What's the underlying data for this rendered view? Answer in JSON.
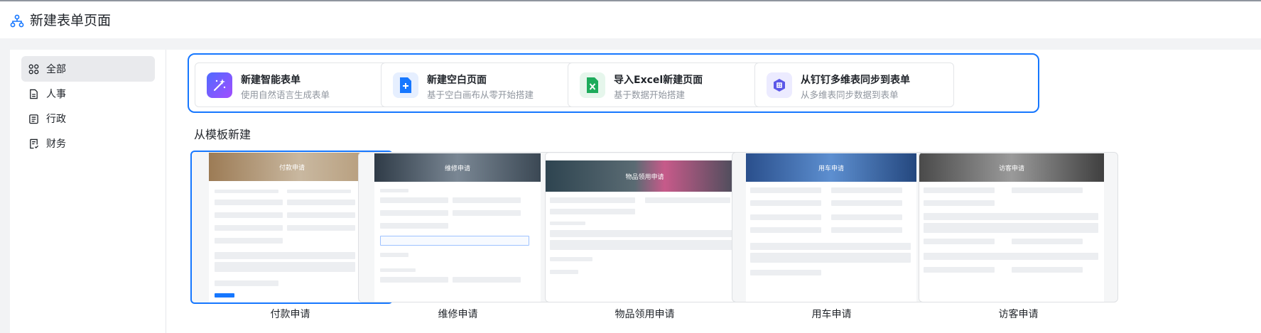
{
  "header": {
    "title": "新建表单页面"
  },
  "sidebar": {
    "items": [
      {
        "label": "全部",
        "icon": "grid-icon",
        "active": true
      },
      {
        "label": "人事",
        "icon": "document-icon",
        "active": false
      },
      {
        "label": "行政",
        "icon": "calendar-icon",
        "active": false
      },
      {
        "label": "财务",
        "icon": "receipt-icon",
        "active": false
      }
    ]
  },
  "quick": [
    {
      "title": "新建智能表单",
      "desc": "使用自然语言生成表单",
      "icon": "magic-wand-icon",
      "color": "#7b5cff"
    },
    {
      "title": "新建空白页面",
      "desc": "基于空白画布从零开始搭建",
      "icon": "blank-page-icon",
      "color": "#1677ff"
    },
    {
      "title": "导入Excel新建页面",
      "desc": "基于数据开始搭建",
      "icon": "excel-icon",
      "color": "#1dab5b"
    },
    {
      "title": "从钉钉多维表同步到表单",
      "desc": "从多维表同步数据到表单",
      "icon": "multi-table-icon",
      "color": "#5b57e8"
    }
  ],
  "templates": {
    "section_title": "从模板新建",
    "items": [
      {
        "name": "付款申请",
        "banner": "付款申请",
        "banner_color": "#a89880"
      },
      {
        "name": "维修申请",
        "banner": "维修申请",
        "banner_color": "#4e5a66"
      },
      {
        "name": "物品领用申请",
        "banner": "物品领用申请",
        "banner_color": "#3d4a52"
      },
      {
        "name": "用车申请",
        "banner": "用车申请",
        "banner_color": "#3f6fb0"
      },
      {
        "name": "访客申请",
        "banner": "访客申请",
        "banner_color": "#555555"
      }
    ]
  },
  "accent": "#1677ff"
}
